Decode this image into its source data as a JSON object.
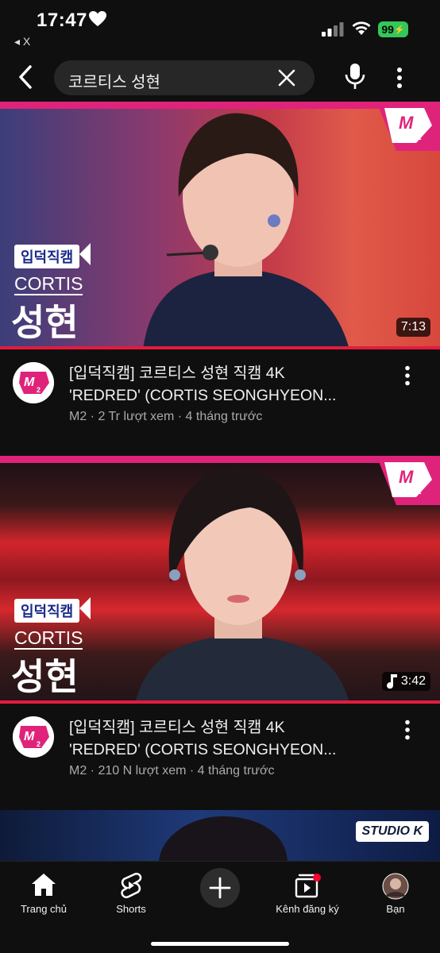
{
  "status": {
    "time": "17:47",
    "back_app": "◂ X",
    "battery": "99"
  },
  "search": {
    "query": "코르티스 성현"
  },
  "videos": [
    {
      "tag": "입덕직캠",
      "group": "CORTIS",
      "name": "성현",
      "duration": "7:13",
      "title_line1": "[입덕직캠] 코르티스 성현 직캠 4K",
      "title_line2": "'REDRED' (CORTIS SEONGHYEON...",
      "subtitle": "M2 · 2 Tr lượt xem · 4 tháng trước",
      "music": false
    },
    {
      "tag": "입덕직캠",
      "group": "CORTIS",
      "name": "성현",
      "duration": "3:42",
      "title_line1": "[입덕직캠] 코르티스 성현 직캠 4K",
      "title_line2": "'REDRED' (CORTIS SEONGHYEON...",
      "subtitle": "M2 · 210 N lượt xem · 4 tháng trước",
      "music": true
    }
  ],
  "thumb3": {
    "logo_text": "STUDIO K"
  },
  "nav": {
    "home": "Trang chủ",
    "shorts": "Shorts",
    "subscriptions": "Kênh đăng ký",
    "you": "Bạn"
  },
  "colors": {
    "accent_pink": "#e0237a",
    "progress_red": "#e31b3e",
    "battery_green": "#34c759"
  },
  "icons": [
    "heart-icon",
    "signal-icon",
    "wifi-icon",
    "back-icon",
    "clear-icon",
    "mic-icon",
    "more-vert-icon",
    "home-icon",
    "shorts-icon",
    "plus-icon",
    "subscriptions-icon",
    "music-note-icon"
  ]
}
